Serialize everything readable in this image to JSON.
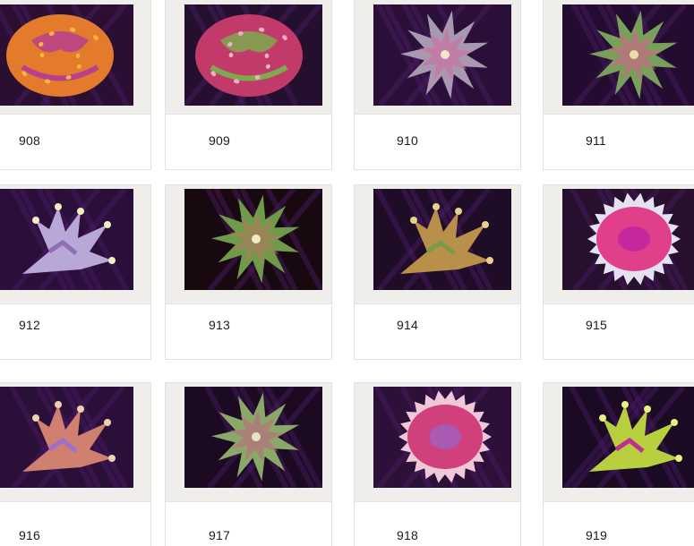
{
  "gallery": {
    "items": [
      {
        "number": "908",
        "colors": {
          "bg": "#2a0f33",
          "body": "#e37a2c",
          "accent": "#b8408f",
          "tip": "#f4b640"
        },
        "shape": "brain"
      },
      {
        "number": "909",
        "colors": {
          "bg": "#24102e",
          "body": "#c23a6a",
          "accent": "#7fa94c",
          "tip": "#e8b2c4"
        },
        "shape": "brain"
      },
      {
        "number": "910",
        "colors": {
          "bg": "#2a1038",
          "body": "#a898b0",
          "accent": "#d06aa0",
          "tip": "#f2e6c8"
        },
        "shape": "star"
      },
      {
        "number": "911",
        "colors": {
          "bg": "#230c30",
          "body": "#79a05a",
          "accent": "#d7608e",
          "tip": "#e8e0a8"
        },
        "shape": "star"
      },
      {
        "number": "912",
        "colors": {
          "bg": "#2a0f3a",
          "body": "#b8a8d8",
          "accent": "#8d6fb8",
          "tip": "#f2f0c0"
        },
        "shape": "branch"
      },
      {
        "number": "913",
        "colors": {
          "bg": "#17090f",
          "body": "#6e9a4a",
          "accent": "#b57a60",
          "tip": "#f0ecc8"
        },
        "shape": "star"
      },
      {
        "number": "914",
        "colors": {
          "bg": "#1f0d28",
          "body": "#b8904a",
          "accent": "#7a9a48",
          "tip": "#e8d090"
        },
        "shape": "branch"
      },
      {
        "number": "915",
        "colors": {
          "bg": "#26102e",
          "body": "#e0408a",
          "accent": "#c020a0",
          "tip": "#e4e2f0"
        },
        "shape": "disc"
      },
      {
        "number": "916",
        "colors": {
          "bg": "#2a0f38",
          "body": "#d08070",
          "accent": "#a070c8",
          "tip": "#f0d0b0"
        },
        "shape": "branch"
      },
      {
        "number": "917",
        "colors": {
          "bg": "#1c0a22",
          "body": "#8aa868",
          "accent": "#c06880",
          "tip": "#e8e4c8"
        },
        "shape": "star"
      },
      {
        "number": "918",
        "colors": {
          "bg": "#2c1038",
          "body": "#d0407a",
          "accent": "#a060c0",
          "tip": "#f0c8d8"
        },
        "shape": "disc"
      },
      {
        "number": "919",
        "colors": {
          "bg": "#1a0a24",
          "body": "#b8d040",
          "accent": "#c03090",
          "tip": "#e8f080"
        },
        "shape": "branch"
      }
    ]
  }
}
